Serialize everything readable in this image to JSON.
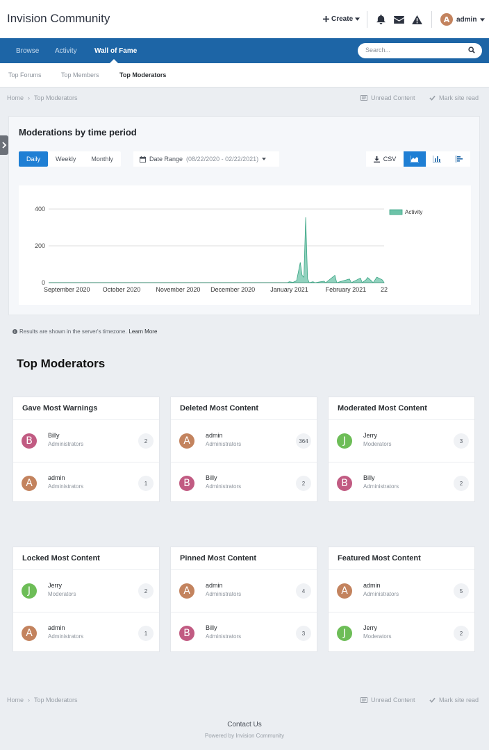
{
  "header": {
    "site_title": "Invision Community",
    "create_label": "Create",
    "user_name": "admin",
    "user_initial": "A"
  },
  "nav": {
    "items": [
      {
        "label": "Browse"
      },
      {
        "label": "Activity"
      },
      {
        "label": "Wall of Fame"
      }
    ],
    "search_placeholder": "Search..."
  },
  "subnav": {
    "items": [
      {
        "label": "Top Forums"
      },
      {
        "label": "Top Members"
      },
      {
        "label": "Top Moderators"
      }
    ]
  },
  "breadcrumb": {
    "home": "Home",
    "separator": "›",
    "current": "Top Moderators",
    "unread": "Unread Content",
    "mark_read": "Mark site read"
  },
  "chart_panel": {
    "title": "Moderations by time period",
    "periods": [
      "Daily",
      "Weekly",
      "Monthly"
    ],
    "date_range_label": "Date Range",
    "date_range_value": "(08/22/2020 - 02/22/2021)",
    "csv_label": "CSV"
  },
  "chart_data": {
    "type": "area",
    "series": [
      {
        "name": "Activity",
        "color": "#6cc3a8"
      }
    ],
    "ylim": [
      0,
      400
    ],
    "y_ticks": [
      "0",
      "200",
      "400"
    ],
    "x_tick_labels": [
      "September 2020",
      "October 2020",
      "November 2020",
      "December 2020",
      "January 2021",
      "February 2021",
      "22"
    ],
    "points": [
      [
        "2020-08-22",
        0
      ],
      [
        "2020-12-31",
        0
      ],
      [
        "2021-01-01",
        5
      ],
      [
        "2021-01-03",
        2
      ],
      [
        "2021-01-05",
        10
      ],
      [
        "2021-01-07",
        110
      ],
      [
        "2021-01-08",
        40
      ],
      [
        "2021-01-09",
        30
      ],
      [
        "2021-01-10",
        355
      ],
      [
        "2021-01-11",
        20
      ],
      [
        "2021-01-12",
        0
      ],
      [
        "2021-01-14",
        5
      ],
      [
        "2021-01-15",
        0
      ],
      [
        "2021-01-20",
        8
      ],
      [
        "2021-01-21",
        0
      ],
      [
        "2021-01-26",
        40
      ],
      [
        "2021-01-27",
        0
      ],
      [
        "2021-02-03",
        20
      ],
      [
        "2021-02-04",
        0
      ],
      [
        "2021-02-09",
        25
      ],
      [
        "2021-02-10",
        0
      ],
      [
        "2021-02-12",
        15
      ],
      [
        "2021-02-13",
        28
      ],
      [
        "2021-02-15",
        10
      ],
      [
        "2021-02-16",
        0
      ],
      [
        "2021-02-18",
        30
      ],
      [
        "2021-02-19",
        25
      ],
      [
        "2021-02-21",
        15
      ],
      [
        "2021-02-22",
        0
      ]
    ],
    "legend_position": "top-right",
    "grid": true
  },
  "tz_note": "Results are shown in the server's timezone.",
  "tz_link": "Learn More",
  "section_title": "Top Moderators",
  "cards": [
    {
      "title": "Gave Most Warnings",
      "rows": [
        {
          "initial": "B",
          "name": "Billy",
          "group": "Administrators",
          "count": "2",
          "color": "#c15b82"
        },
        {
          "initial": "A",
          "name": "admin",
          "group": "Administrators",
          "count": "1",
          "color": "#c3835e"
        }
      ]
    },
    {
      "title": "Deleted Most Content",
      "rows": [
        {
          "initial": "A",
          "name": "admin",
          "group": "Administrators",
          "count": "364",
          "color": "#c3835e"
        },
        {
          "initial": "B",
          "name": "Billy",
          "group": "Administrators",
          "count": "2",
          "color": "#c15b82"
        }
      ]
    },
    {
      "title": "Moderated Most Content",
      "rows": [
        {
          "initial": "J",
          "name": "Jerry",
          "group": "Moderators",
          "count": "3",
          "color": "#6dbd57"
        },
        {
          "initial": "B",
          "name": "Billy",
          "group": "Administrators",
          "count": "2",
          "color": "#c15b82"
        }
      ]
    },
    {
      "title": "Locked Most Content",
      "rows": [
        {
          "initial": "J",
          "name": "Jerry",
          "group": "Moderators",
          "count": "2",
          "color": "#6dbd57"
        },
        {
          "initial": "A",
          "name": "admin",
          "group": "Administrators",
          "count": "1",
          "color": "#c3835e"
        }
      ]
    },
    {
      "title": "Pinned Most Content",
      "rows": [
        {
          "initial": "A",
          "name": "admin",
          "group": "Administrators",
          "count": "4",
          "color": "#c3835e"
        },
        {
          "initial": "B",
          "name": "Billy",
          "group": "Administrators",
          "count": "3",
          "color": "#c15b82"
        }
      ]
    },
    {
      "title": "Featured Most Content",
      "rows": [
        {
          "initial": "A",
          "name": "admin",
          "group": "Administrators",
          "count": "5",
          "color": "#c3835e"
        },
        {
          "initial": "J",
          "name": "Jerry",
          "group": "Moderators",
          "count": "2",
          "color": "#6dbd57"
        }
      ]
    }
  ],
  "footer": {
    "contact": "Contact Us",
    "powered": "Powered by Invision Community"
  }
}
